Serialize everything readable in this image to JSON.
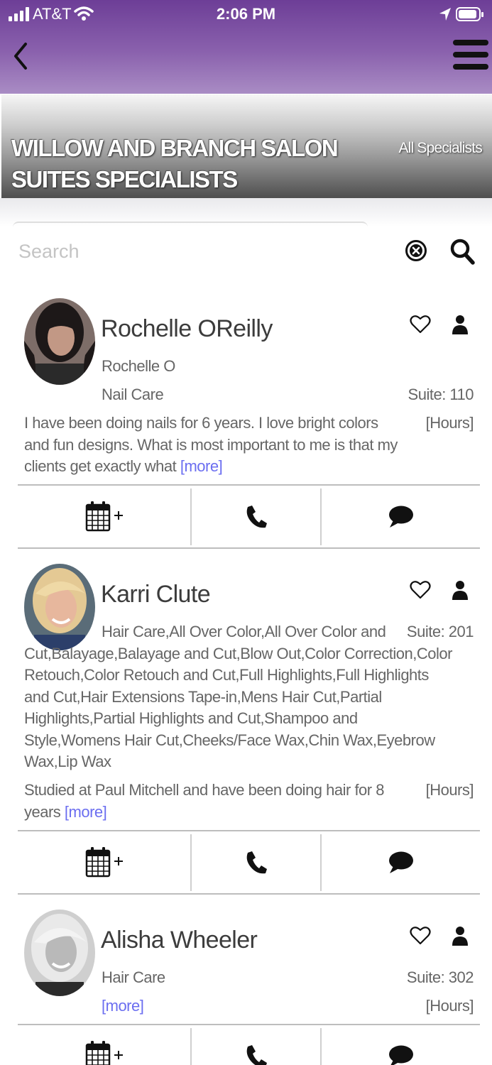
{
  "status_bar": {
    "carrier": "AT&T",
    "time": "2:06 PM"
  },
  "banner": {
    "title": "WILLOW AND BRANCH SALON SUITES SPECIALISTS",
    "subtitle": "All Specialists"
  },
  "search": {
    "placeholder": "Search",
    "value": ""
  },
  "colors": {
    "header_purple": "#6d3e97",
    "link_blue": "#6b6ef0"
  },
  "specialists": [
    {
      "name": "Rochelle OReilly",
      "nickname": "Rochelle O",
      "services": "Nail Care",
      "suite": "Suite: 110",
      "bio": "I have been doing nails for 6 years. I love bright colors and fun designs. What is most important to me is that my clients get exactly what",
      "more": "[more]",
      "hours": "[Hours]"
    },
    {
      "name": "Karri Clute",
      "services": "Hair Care,All Over Color,All Over Color and Cut,Balayage,Balayage and Cut,Blow Out,Color Correction,Color Retouch,Color Retouch and Cut,Full Highlights,Full Highlights and Cut,Hair Extensions Tape-in,Mens Hair Cut,Partial Highlights,Partial Highlights and Cut,Shampoo and Style,Womens Hair Cut,Cheeks/Face Wax,Chin Wax,Eyebrow Wax,Lip Wax",
      "suite": "Suite: 201",
      "bio": "Studied at Paul Mitchell and have been doing hair for 8 years",
      "more": "[more]",
      "hours": "[Hours]"
    },
    {
      "name": "Alisha Wheeler",
      "services": "Hair Care",
      "suite": "Suite: 302",
      "more": "[more]",
      "hours": "[Hours]"
    }
  ],
  "icons": {
    "book": "calendar-plus-icon",
    "call": "phone-icon",
    "message": "chat-bubble-icon",
    "favorite": "heart-icon",
    "profile": "person-icon"
  }
}
